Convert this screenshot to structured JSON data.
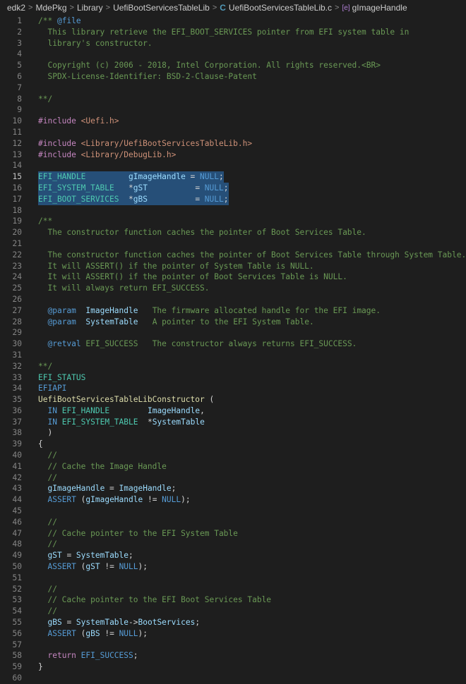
{
  "breadcrumb": {
    "items": [
      "edk2",
      "MdePkg",
      "Library",
      "UefiBootServicesTableLib",
      "UefiBootServicesTableLib.c",
      "gImageHandle"
    ],
    "separator": ">",
    "file_icon": "C",
    "symbol_icon": "[e]"
  },
  "selected_lines": [
    15,
    16,
    17
  ],
  "lines": [
    {
      "n": "1",
      "tokens": [
        {
          "t": "/** ",
          "c": "comment"
        },
        {
          "t": "@file",
          "c": "tag"
        }
      ]
    },
    {
      "n": "2",
      "tokens": [
        {
          "t": "  This library retrieve the EFI_BOOT_SERVICES pointer from EFI system table in",
          "c": "comment"
        }
      ]
    },
    {
      "n": "3",
      "tokens": [
        {
          "t": "  library's constructor.",
          "c": "comment"
        }
      ]
    },
    {
      "n": "4",
      "tokens": []
    },
    {
      "n": "5",
      "tokens": [
        {
          "t": "  Copyright (c) 2006 - 2018, Intel Corporation. All rights reserved.<BR>",
          "c": "comment"
        }
      ]
    },
    {
      "n": "6",
      "tokens": [
        {
          "t": "  SPDX-License-Identifier: BSD-2-Clause-Patent",
          "c": "comment"
        }
      ]
    },
    {
      "n": "7",
      "tokens": []
    },
    {
      "n": "8",
      "tokens": [
        {
          "t": "**/",
          "c": "comment"
        }
      ]
    },
    {
      "n": "9",
      "tokens": []
    },
    {
      "n": "10",
      "tokens": [
        {
          "t": "#include",
          "c": "pp"
        },
        {
          "t": " <Uefi.h>",
          "c": "str"
        }
      ]
    },
    {
      "n": "11",
      "tokens": []
    },
    {
      "n": "12",
      "tokens": [
        {
          "t": "#include",
          "c": "pp"
        },
        {
          "t": " <Library/UefiBootServicesTableLib.h>",
          "c": "str"
        }
      ]
    },
    {
      "n": "13",
      "tokens": [
        {
          "t": "#include",
          "c": "pp"
        },
        {
          "t": " <Library/DebugLib.h>",
          "c": "str"
        }
      ]
    },
    {
      "n": "14",
      "tokens": []
    },
    {
      "n": "15",
      "tokens": [
        {
          "t": "EFI_HANDLE",
          "c": "type"
        },
        {
          "t": "         ",
          "c": "text"
        },
        {
          "t": "gImageHandle",
          "c": "var"
        },
        {
          "t": " = ",
          "c": "text"
        },
        {
          "t": "NULL",
          "c": "kw"
        },
        {
          "t": ";",
          "c": "text"
        }
      ]
    },
    {
      "n": "16",
      "tokens": [
        {
          "t": "EFI_SYSTEM_TABLE",
          "c": "type"
        },
        {
          "t": "   ",
          "c": "text"
        },
        {
          "t": "*",
          "c": "text"
        },
        {
          "t": "gST",
          "c": "var"
        },
        {
          "t": "          = ",
          "c": "text"
        },
        {
          "t": "NULL",
          "c": "kw"
        },
        {
          "t": ";",
          "c": "text"
        }
      ]
    },
    {
      "n": "17",
      "tokens": [
        {
          "t": "EFI_BOOT_SERVICES",
          "c": "type"
        },
        {
          "t": "  ",
          "c": "text"
        },
        {
          "t": "*",
          "c": "text"
        },
        {
          "t": "gBS",
          "c": "var"
        },
        {
          "t": "          = ",
          "c": "text"
        },
        {
          "t": "NULL",
          "c": "kw"
        },
        {
          "t": ";",
          "c": "text"
        }
      ]
    },
    {
      "n": "18",
      "tokens": []
    },
    {
      "n": "19",
      "tokens": [
        {
          "t": "/**",
          "c": "comment"
        }
      ]
    },
    {
      "n": "20",
      "tokens": [
        {
          "t": "  The constructor function caches the pointer of Boot Services Table.",
          "c": "comment"
        }
      ]
    },
    {
      "n": "21",
      "tokens": []
    },
    {
      "n": "22",
      "tokens": [
        {
          "t": "  The constructor function caches the pointer of Boot Services Table through System Table.",
          "c": "comment"
        }
      ]
    },
    {
      "n": "23",
      "tokens": [
        {
          "t": "  It will ASSERT() if the pointer of System Table is NULL.",
          "c": "comment"
        }
      ]
    },
    {
      "n": "24",
      "tokens": [
        {
          "t": "  It will ASSERT() if the pointer of Boot Services Table is NULL.",
          "c": "comment"
        }
      ]
    },
    {
      "n": "25",
      "tokens": [
        {
          "t": "  It will always return EFI_SUCCESS.",
          "c": "comment"
        }
      ]
    },
    {
      "n": "26",
      "tokens": []
    },
    {
      "n": "27",
      "tokens": [
        {
          "t": "  ",
          "c": "comment"
        },
        {
          "t": "@param",
          "c": "tag"
        },
        {
          "t": "  ",
          "c": "comment"
        },
        {
          "t": "ImageHandle",
          "c": "var"
        },
        {
          "t": "   The firmware allocated handle for the EFI image.",
          "c": "comment"
        }
      ]
    },
    {
      "n": "28",
      "tokens": [
        {
          "t": "  ",
          "c": "comment"
        },
        {
          "t": "@param",
          "c": "tag"
        },
        {
          "t": "  ",
          "c": "comment"
        },
        {
          "t": "SystemTable",
          "c": "var"
        },
        {
          "t": "   A pointer to the EFI System Table.",
          "c": "comment"
        }
      ]
    },
    {
      "n": "29",
      "tokens": []
    },
    {
      "n": "30",
      "tokens": [
        {
          "t": "  ",
          "c": "comment"
        },
        {
          "t": "@retval",
          "c": "tag"
        },
        {
          "t": " EFI_SUCCESS   The constructor always returns EFI_SUCCESS.",
          "c": "comment"
        }
      ]
    },
    {
      "n": "31",
      "tokens": []
    },
    {
      "n": "32",
      "tokens": [
        {
          "t": "**/",
          "c": "comment"
        }
      ]
    },
    {
      "n": "33",
      "tokens": [
        {
          "t": "EFI_STATUS",
          "c": "type"
        }
      ]
    },
    {
      "n": "34",
      "tokens": [
        {
          "t": "EFIAPI",
          "c": "kw"
        }
      ]
    },
    {
      "n": "35",
      "tokens": [
        {
          "t": "UefiBootServicesTableLibConstructor",
          "c": "fn"
        },
        {
          "t": " (",
          "c": "text"
        }
      ]
    },
    {
      "n": "36",
      "tokens": [
        {
          "t": "  ",
          "c": "text"
        },
        {
          "t": "IN",
          "c": "kw"
        },
        {
          "t": " ",
          "c": "text"
        },
        {
          "t": "EFI_HANDLE",
          "c": "type"
        },
        {
          "t": "        ",
          "c": "text"
        },
        {
          "t": "ImageHandle",
          "c": "var"
        },
        {
          "t": ",",
          "c": "text"
        }
      ]
    },
    {
      "n": "37",
      "tokens": [
        {
          "t": "  ",
          "c": "text"
        },
        {
          "t": "IN",
          "c": "kw"
        },
        {
          "t": " ",
          "c": "text"
        },
        {
          "t": "EFI_SYSTEM_TABLE",
          "c": "type"
        },
        {
          "t": "  *",
          "c": "text"
        },
        {
          "t": "SystemTable",
          "c": "var"
        }
      ]
    },
    {
      "n": "38",
      "tokens": [
        {
          "t": "  )",
          "c": "text"
        }
      ]
    },
    {
      "n": "39",
      "tokens": [
        {
          "t": "{",
          "c": "text"
        }
      ]
    },
    {
      "n": "40",
      "tokens": [
        {
          "t": "  //",
          "c": "comment"
        }
      ]
    },
    {
      "n": "41",
      "tokens": [
        {
          "t": "  // Cache the Image Handle",
          "c": "comment"
        }
      ]
    },
    {
      "n": "42",
      "tokens": [
        {
          "t": "  //",
          "c": "comment"
        }
      ]
    },
    {
      "n": "43",
      "tokens": [
        {
          "t": "  ",
          "c": "text"
        },
        {
          "t": "gImageHandle",
          "c": "var"
        },
        {
          "t": " = ",
          "c": "text"
        },
        {
          "t": "ImageHandle",
          "c": "var"
        },
        {
          "t": ";",
          "c": "text"
        }
      ]
    },
    {
      "n": "44",
      "tokens": [
        {
          "t": "  ",
          "c": "text"
        },
        {
          "t": "ASSERT",
          "c": "kw"
        },
        {
          "t": " (",
          "c": "text"
        },
        {
          "t": "gImageHandle",
          "c": "var"
        },
        {
          "t": " != ",
          "c": "text"
        },
        {
          "t": "NULL",
          "c": "kw"
        },
        {
          "t": ");",
          "c": "text"
        }
      ]
    },
    {
      "n": "45",
      "tokens": []
    },
    {
      "n": "46",
      "tokens": [
        {
          "t": "  //",
          "c": "comment"
        }
      ]
    },
    {
      "n": "47",
      "tokens": [
        {
          "t": "  // Cache pointer to the EFI System Table",
          "c": "comment"
        }
      ]
    },
    {
      "n": "48",
      "tokens": [
        {
          "t": "  //",
          "c": "comment"
        }
      ]
    },
    {
      "n": "49",
      "tokens": [
        {
          "t": "  ",
          "c": "text"
        },
        {
          "t": "gST",
          "c": "var"
        },
        {
          "t": " = ",
          "c": "text"
        },
        {
          "t": "SystemTable",
          "c": "var"
        },
        {
          "t": ";",
          "c": "text"
        }
      ]
    },
    {
      "n": "50",
      "tokens": [
        {
          "t": "  ",
          "c": "text"
        },
        {
          "t": "ASSERT",
          "c": "kw"
        },
        {
          "t": " (",
          "c": "text"
        },
        {
          "t": "gST",
          "c": "var"
        },
        {
          "t": " != ",
          "c": "text"
        },
        {
          "t": "NULL",
          "c": "kw"
        },
        {
          "t": ");",
          "c": "text"
        }
      ]
    },
    {
      "n": "51",
      "tokens": []
    },
    {
      "n": "52",
      "tokens": [
        {
          "t": "  //",
          "c": "comment"
        }
      ]
    },
    {
      "n": "53",
      "tokens": [
        {
          "t": "  // Cache pointer to the EFI Boot Services Table",
          "c": "comment"
        }
      ]
    },
    {
      "n": "54",
      "tokens": [
        {
          "t": "  //",
          "c": "comment"
        }
      ]
    },
    {
      "n": "55",
      "tokens": [
        {
          "t": "  ",
          "c": "text"
        },
        {
          "t": "gBS",
          "c": "var"
        },
        {
          "t": " = ",
          "c": "text"
        },
        {
          "t": "SystemTable",
          "c": "var"
        },
        {
          "t": "->",
          "c": "text"
        },
        {
          "t": "BootServices",
          "c": "var"
        },
        {
          "t": ";",
          "c": "text"
        }
      ]
    },
    {
      "n": "56",
      "tokens": [
        {
          "t": "  ",
          "c": "text"
        },
        {
          "t": "ASSERT",
          "c": "kw"
        },
        {
          "t": " (",
          "c": "text"
        },
        {
          "t": "gBS",
          "c": "var"
        },
        {
          "t": " != ",
          "c": "text"
        },
        {
          "t": "NULL",
          "c": "kw"
        },
        {
          "t": ");",
          "c": "text"
        }
      ]
    },
    {
      "n": "57",
      "tokens": []
    },
    {
      "n": "58",
      "tokens": [
        {
          "t": "  ",
          "c": "text"
        },
        {
          "t": "return",
          "c": "pp"
        },
        {
          "t": " ",
          "c": "text"
        },
        {
          "t": "EFI_SUCCESS",
          "c": "kw"
        },
        {
          "t": ";",
          "c": "text"
        }
      ]
    },
    {
      "n": "59",
      "tokens": [
        {
          "t": "}",
          "c": "text"
        }
      ]
    },
    {
      "n": "60",
      "tokens": []
    }
  ]
}
